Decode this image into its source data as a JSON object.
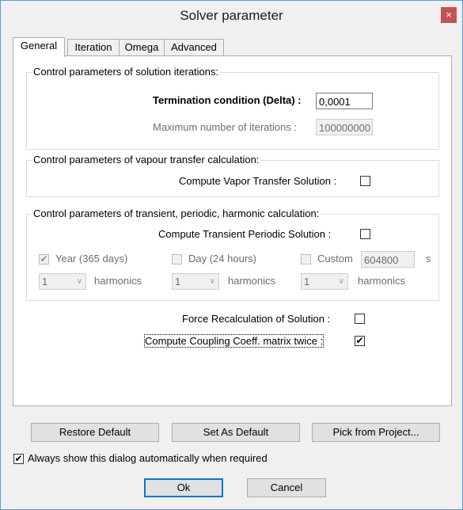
{
  "window": {
    "title": "Solver parameter",
    "close": "×"
  },
  "tabs": [
    "General",
    "Iteration",
    "Omega",
    "Advanced"
  ],
  "iterations": {
    "group_title": "Control parameters of solution iterations:",
    "termination_label": "Termination condition (Delta) :",
    "termination_value": "0,0001",
    "max_iter_label": "Maximum number of iterations :",
    "max_iter_value": "100000000"
  },
  "vapour": {
    "group_title": "Control parameters of vapour transfer calculation:",
    "compute_label": "Compute Vapor Transfer Solution :"
  },
  "transient": {
    "group_title": "Control parameters of transient, periodic, harmonic calculation:",
    "compute_label": "Compute Transient Periodic Solution :",
    "year_label": "Year (365 days)",
    "day_label": "Day (24 hours)",
    "custom_label": "Custom",
    "custom_value": "604800",
    "custom_unit": "s",
    "harmonics_value": "1",
    "harmonics_label": "harmonics"
  },
  "options": {
    "force_label": "Force Recalculation of Solution :",
    "coupling_label": "Compute Coupling Coeff. matrix twice :"
  },
  "buttons": {
    "restore": "Restore Default",
    "set_default": "Set As Default",
    "pick": "Pick from Project...",
    "ok": "Ok",
    "cancel": "Cancel"
  },
  "always_show_label": "Always show this dialog automatically when required",
  "check_glyph": "✔",
  "arrow_glyph": "∨"
}
